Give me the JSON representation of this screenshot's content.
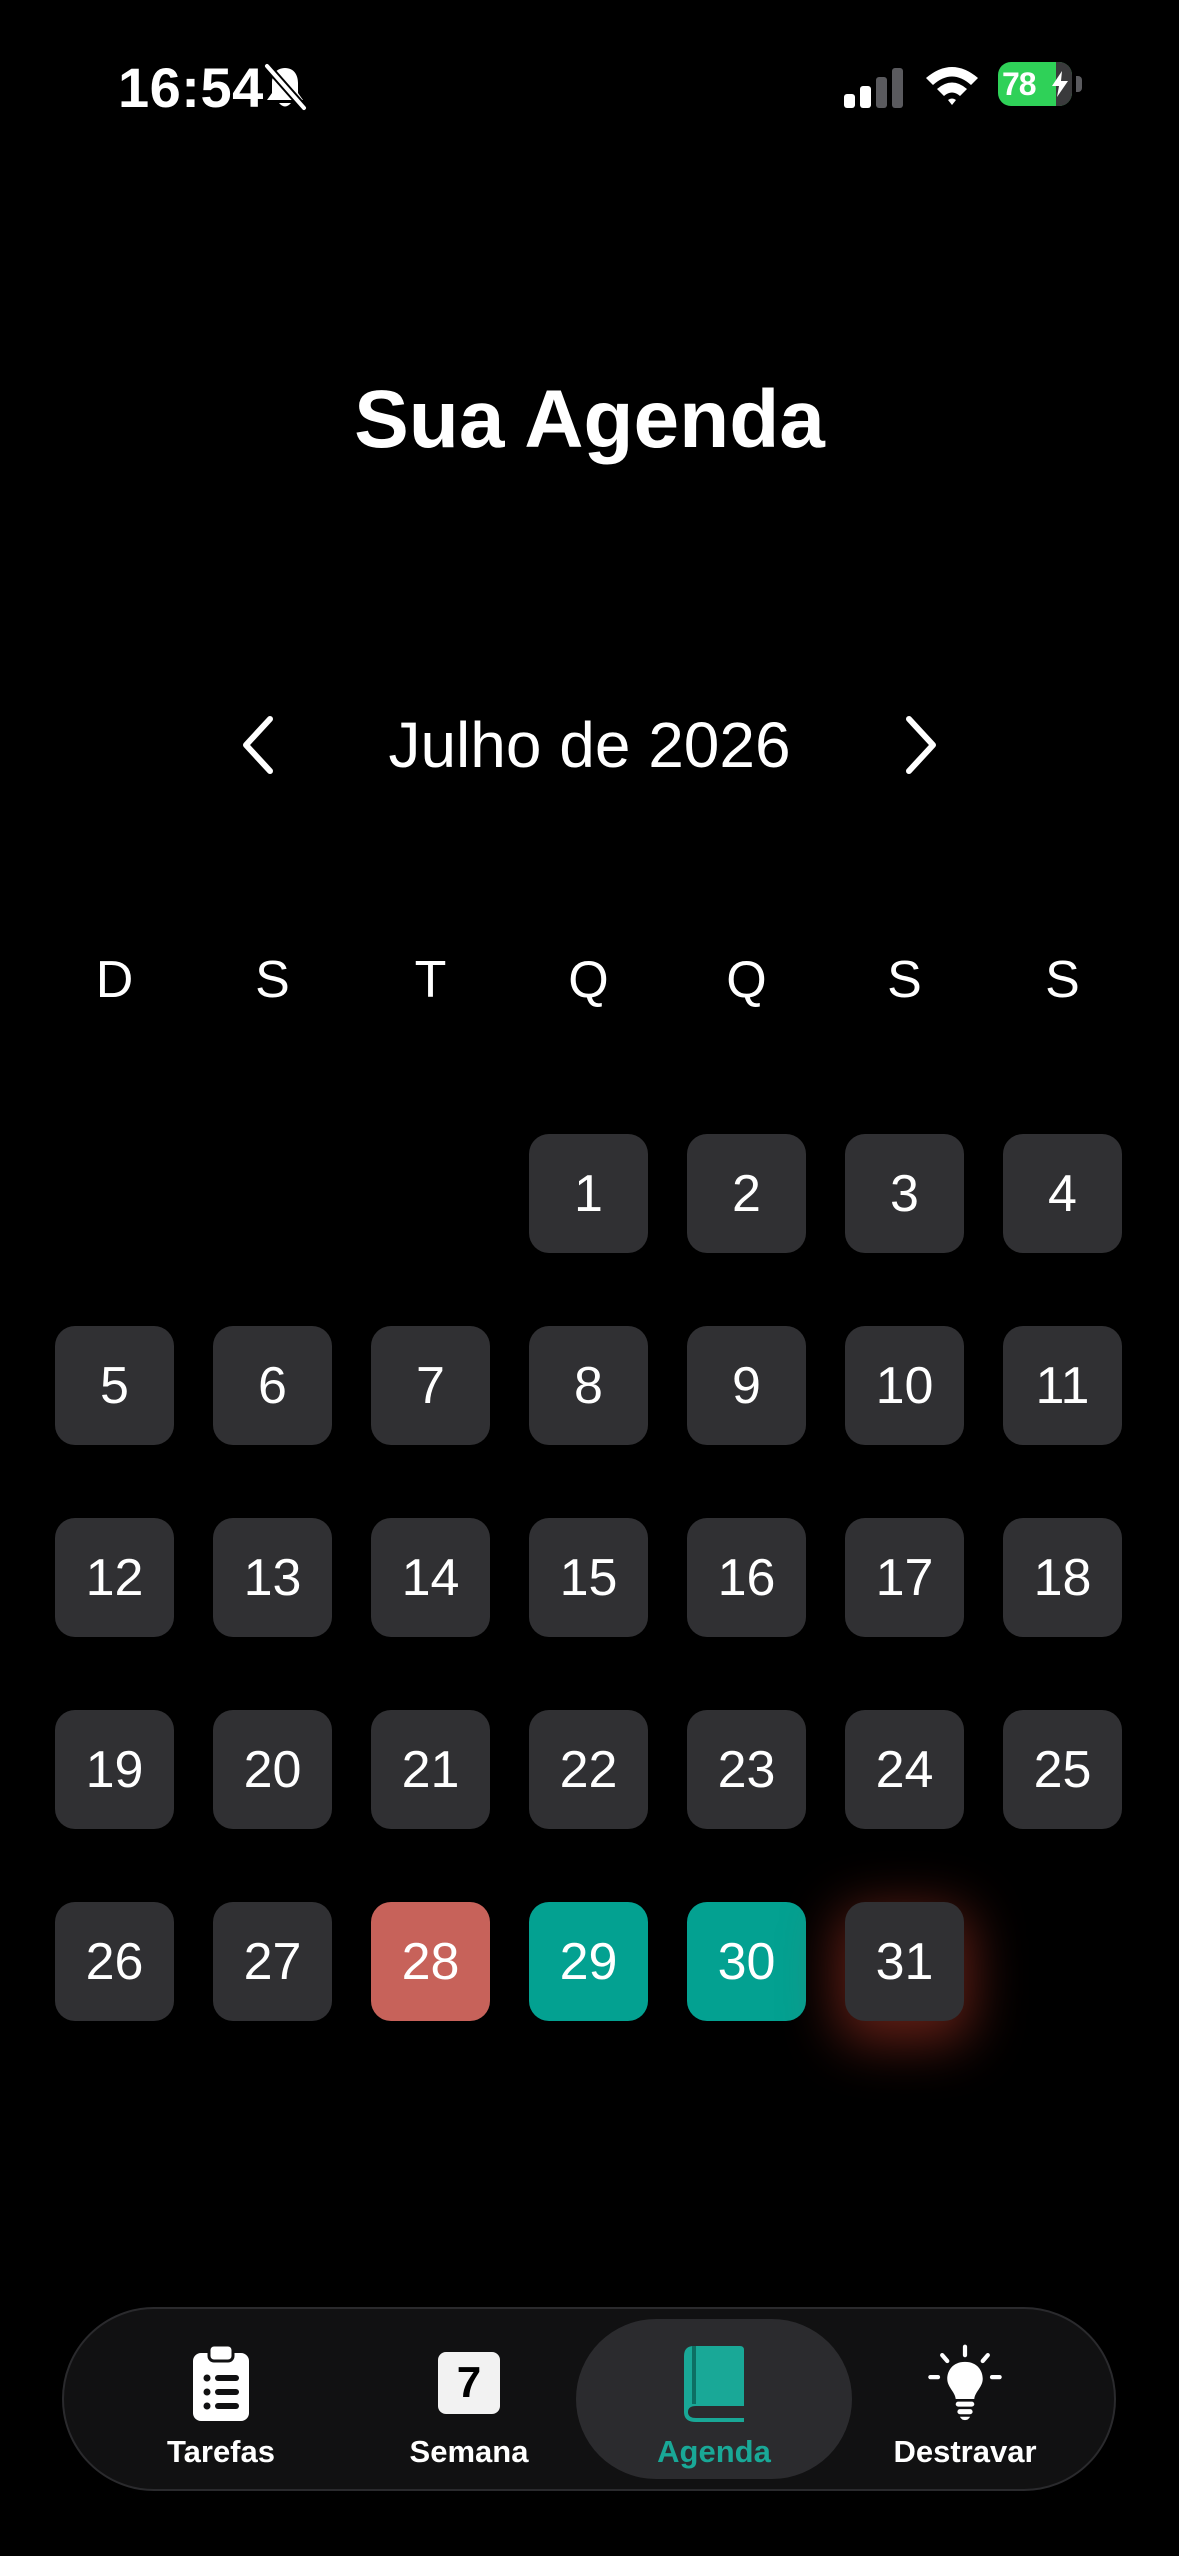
{
  "status_bar": {
    "time": "16:54",
    "battery_level": 78,
    "battery_label": "78",
    "battery_color": "#2fd158"
  },
  "title": "Sua Agenda",
  "calendar": {
    "month_label": "Julho de 2026",
    "weekdays": [
      "D",
      "S",
      "T",
      "Q",
      "Q",
      "S",
      "S"
    ],
    "first_weekday_index": 3,
    "days_in_month": 31,
    "colors": {
      "default_cell": "#303033",
      "overdue_cell": "#c7625a",
      "scheduled_cell": "#03a191",
      "glow": "#b83a2a"
    },
    "day_status": {
      "28": "overdue",
      "29": "scheduled",
      "30": "scheduled",
      "31": "today"
    }
  },
  "tab_bar": {
    "tabs": [
      {
        "key": "tarefas",
        "label": "Tarefas",
        "icon": "clipboard-icon"
      },
      {
        "key": "semana",
        "label": "Semana",
        "icon": "calendar-day-icon",
        "badge": "7"
      },
      {
        "key": "agenda",
        "label": "Agenda",
        "icon": "book-icon"
      },
      {
        "key": "destravar",
        "label": "Destravar",
        "icon": "lightbulb-icon"
      }
    ],
    "active": "agenda",
    "accent_color": "#19a897"
  }
}
